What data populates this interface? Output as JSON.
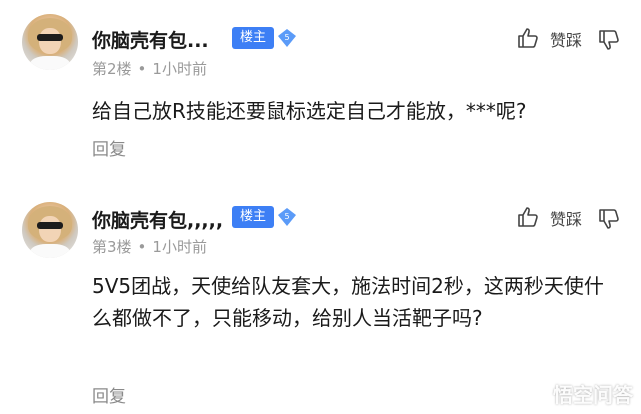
{
  "comments": [
    {
      "author": "你脑壳有包...",
      "badge": "楼主",
      "level": "5",
      "floor": "第2楼",
      "time": "1小时前",
      "vote_label": "赞踩",
      "content": "给自己放R技能还要鼠标选定自己才能放，***呢?",
      "reply_label": "回复"
    },
    {
      "author": "你脑壳有包,,,,,",
      "badge": "楼主",
      "level": "5",
      "floor": "第3楼",
      "time": "1小时前",
      "vote_label": "赞踩",
      "content": "5V5团战，天使给队友套大，施法时间2秒，这两秒天使什么都做不了，只能移动，给别人当活靶子吗?",
      "reply_label": "回复"
    }
  ],
  "meta_separator": "•",
  "watermark": "悟空问答",
  "colors": {
    "badge_bg": "#3d7ff5",
    "level_icon": "#5b9bf8",
    "meta_text": "#9a9a9a"
  },
  "icons": [
    "thumbs-up-icon",
    "thumbs-down-icon",
    "level-diamond-icon",
    "wukong-logo-icon"
  ]
}
